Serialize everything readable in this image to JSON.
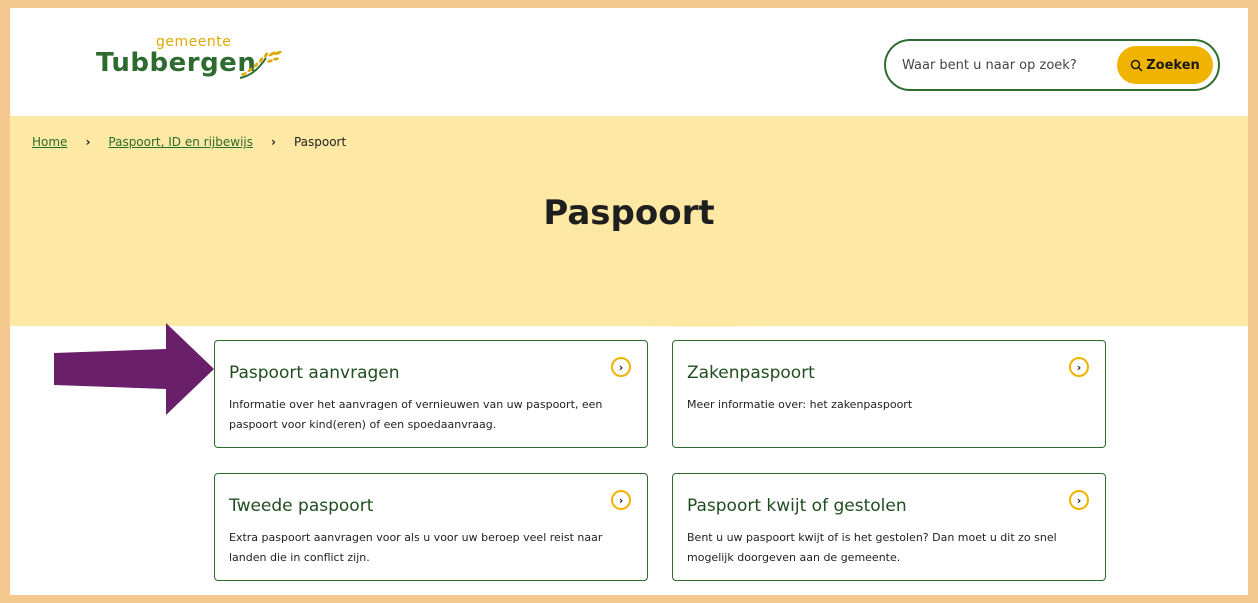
{
  "header": {
    "logo_small": "gemeente",
    "logo_main": "Tubbergen",
    "search_placeholder": "Waar bent u naar op zoek?",
    "search_button": "Zoeken"
  },
  "breadcrumb": {
    "home": "Home",
    "parent": "Paspoort, ID en rijbewijs",
    "current": "Paspoort"
  },
  "page_title": "Paspoort",
  "cards": [
    {
      "title": "Paspoort aanvragen",
      "desc": "Informatie over het aanvragen of vernieuwen van uw paspoort, een paspoort voor kind(eren) of een spoedaanvraag."
    },
    {
      "title": "Zakenpaspoort",
      "desc": "Meer informatie over: het zakenpaspoort"
    },
    {
      "title": "Tweede paspoort",
      "desc": "Extra paspoort aanvragen voor als u voor uw beroep veel reist naar landen die in conflict zijn."
    },
    {
      "title": "Paspoort kwijt of gestolen",
      "desc": "Bent u uw paspoort kwijt of is het gestolen? Dan moet u dit zo snel mogelijk doorgeven aan de gemeente."
    }
  ],
  "colors": {
    "brand_green": "#2e6b2f",
    "accent_yellow": "#f0b400",
    "banner_yellow": "#fde8a4",
    "frame_border": "#f4c88e",
    "annotation_arrow": "#6a1f6b"
  },
  "icons": {
    "search": "search-icon",
    "chevron": "chevron-right-icon",
    "arrow": "annotation-arrow"
  }
}
